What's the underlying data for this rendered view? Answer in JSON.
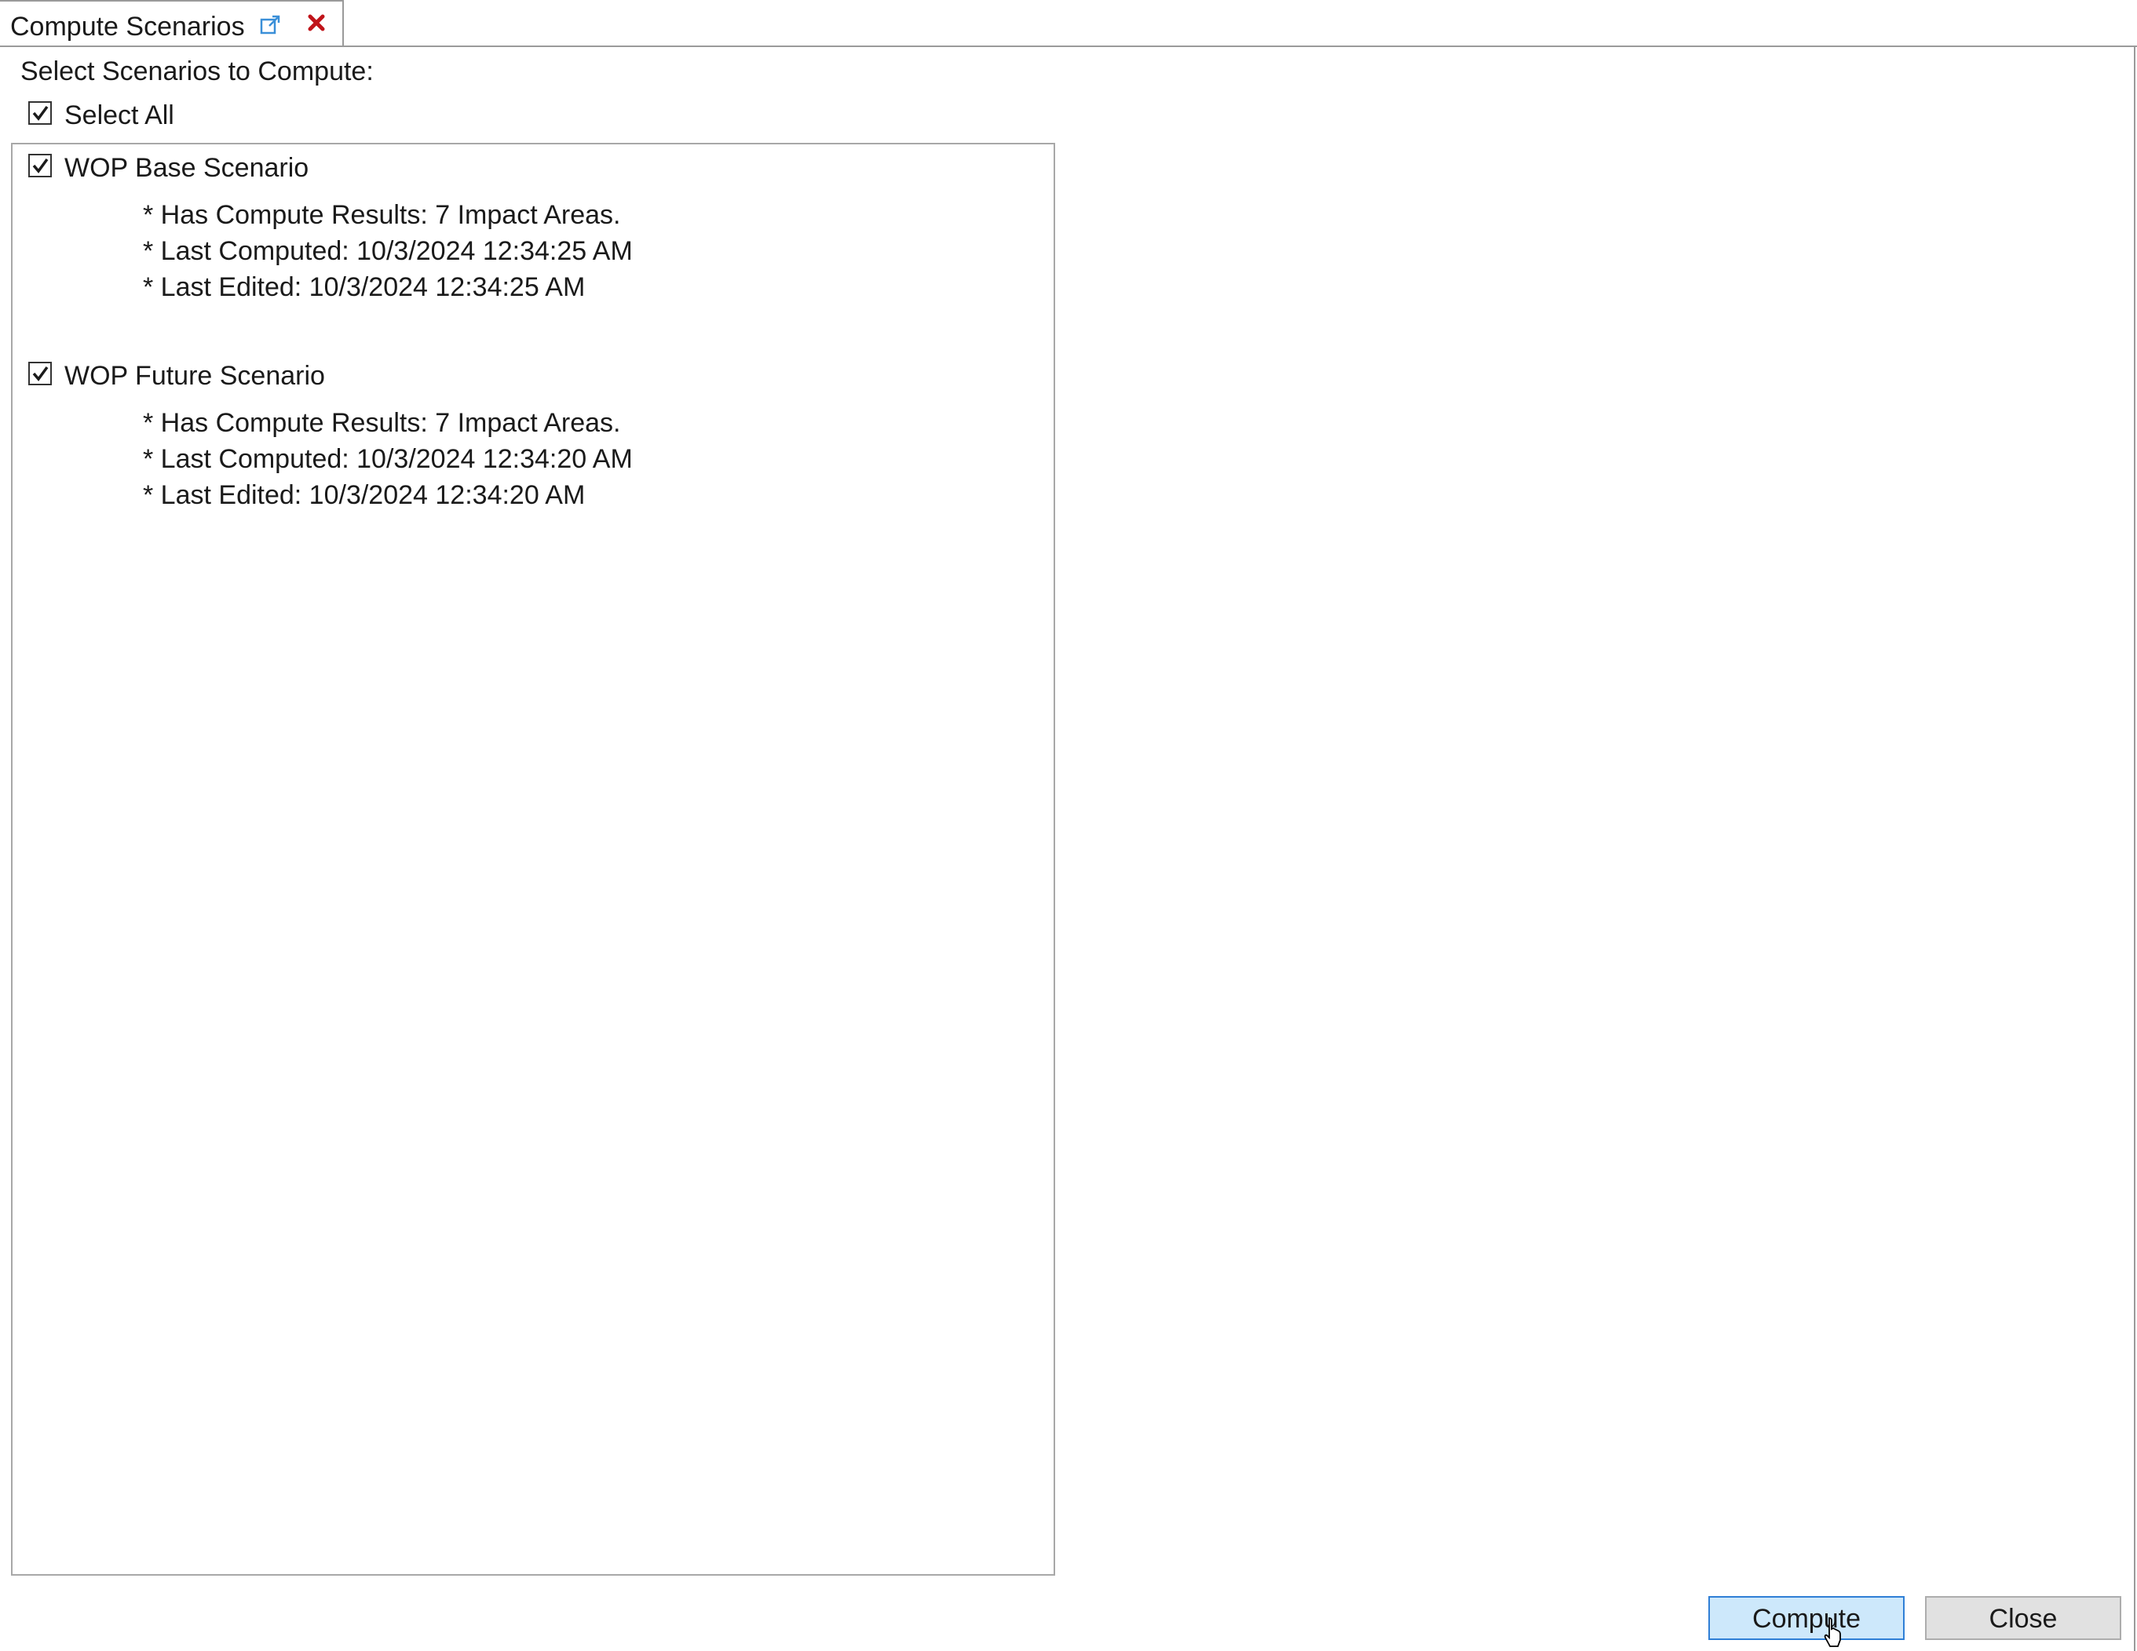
{
  "tab": {
    "title": "Compute Scenarios",
    "popout_icon": "popout-icon",
    "close_icon": "close-icon",
    "close_icon_color": "#c0141a"
  },
  "heading": "Select Scenarios to Compute:",
  "select_all": {
    "label": "Select All",
    "checked": true
  },
  "scenarios": [
    {
      "name": "WOP Base Scenario",
      "checked": true,
      "details": [
        "* Has Compute Results: 7 Impact Areas.",
        "* Last Computed: 10/3/2024 12:34:25 AM",
        "* Last Edited: 10/3/2024 12:34:25 AM"
      ]
    },
    {
      "name": "WOP Future Scenario",
      "checked": true,
      "details": [
        "* Has Compute Results: 7 Impact Areas.",
        "* Last Computed: 10/3/2024 12:34:20 AM",
        "* Last Edited: 10/3/2024 12:34:20 AM"
      ]
    }
  ],
  "buttons": {
    "compute": "Compute",
    "close": "Close"
  },
  "colors": {
    "compute_bg": "#cde8fb",
    "compute_border": "#2f7fd6",
    "close_bg": "#e1e1e1"
  }
}
